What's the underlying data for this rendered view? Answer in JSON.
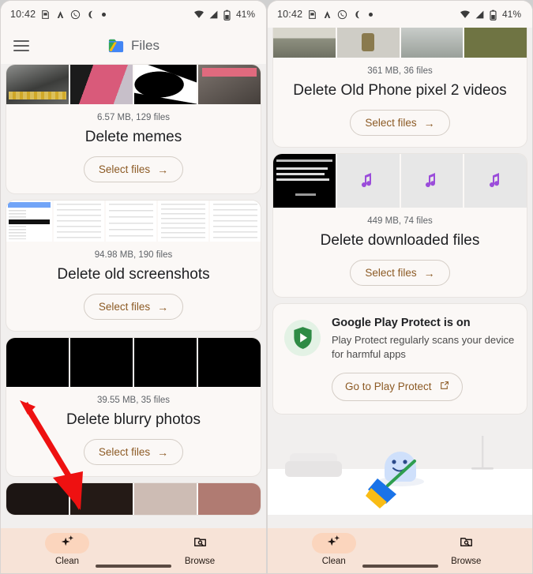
{
  "status_bar": {
    "time": "10:42",
    "battery": "41%",
    "left_icons": [
      "sim-card-icon",
      "adb-icon",
      "whatsapp-icon",
      "do-not-disturb-icon",
      "dot-icon"
    ],
    "right_icons": [
      "wifi-icon",
      "signal-icon",
      "battery-icon"
    ]
  },
  "app_bar": {
    "menu_icon": "hamburger-menu-icon",
    "logo_icon": "files-logo-icon",
    "title": "Files"
  },
  "left_screen": {
    "cards": [
      {
        "meta": "6.57 MB, 129 files",
        "title": "Delete memes",
        "button": "Select files",
        "button_icon": "arrow-right-icon",
        "thumbs": [
          "meme-thumb-1",
          "meme-thumb-2",
          "meme-thumb-3",
          "meme-thumb-4"
        ]
      },
      {
        "meta": "94.98 MB, 190 files",
        "title": "Delete old screenshots",
        "button": "Select files",
        "button_icon": "arrow-right-icon",
        "thumbs": [
          "screenshot-thumb-1",
          "screenshot-thumb-2",
          "screenshot-thumb-3",
          "screenshot-thumb-4",
          "screenshot-thumb-5"
        ]
      },
      {
        "meta": "39.55 MB, 35 files",
        "title": "Delete blurry photos",
        "button": "Select files",
        "button_icon": "arrow-right-icon",
        "thumbs": [
          "blurry-thumb-1",
          "blurry-thumb-2",
          "blurry-thumb-3",
          "blurry-thumb-4"
        ]
      }
    ]
  },
  "right_screen": {
    "cards": [
      {
        "meta": "361 MB, 36 files",
        "title": "Delete Old Phone pixel 2 videos",
        "button": "Select files",
        "button_icon": "arrow-right-icon",
        "thumbs": [
          "video-thumb-1",
          "video-thumb-2",
          "video-thumb-3",
          "video-thumb-4"
        ]
      },
      {
        "meta": "449 MB, 74 files",
        "title": "Delete downloaded files",
        "button": "Select files",
        "button_icon": "arrow-right-icon",
        "thumbs": [
          "download-thumb-quote",
          "music-note-icon",
          "music-note-icon",
          "music-note-icon"
        ]
      }
    ],
    "play_protect": {
      "icon": "play-protect-shield-icon",
      "title": "Google Play Protect is on",
      "description": "Play Protect regularly scans your device for harmful apps",
      "button": "Go to Play Protect",
      "button_icon": "external-link-icon"
    },
    "illustration": "cleaning-mascot-illustration"
  },
  "bottom_nav": {
    "items": [
      {
        "label": "Clean",
        "icon": "sparkle-icon",
        "active": true
      },
      {
        "label": "Browse",
        "icon": "folder-search-icon",
        "active": false
      }
    ]
  },
  "annotation": {
    "type": "red-arrow",
    "color": "#ee1111",
    "points_to": "Clean"
  },
  "colors": {
    "accent": "#8c5a24",
    "nav_background": "#f7e3d7",
    "nav_pill_active": "#fbd5bd",
    "card_background": "#fbf8f6",
    "page_background": "#f1efee",
    "play_protect_green": "#2e8b45"
  }
}
